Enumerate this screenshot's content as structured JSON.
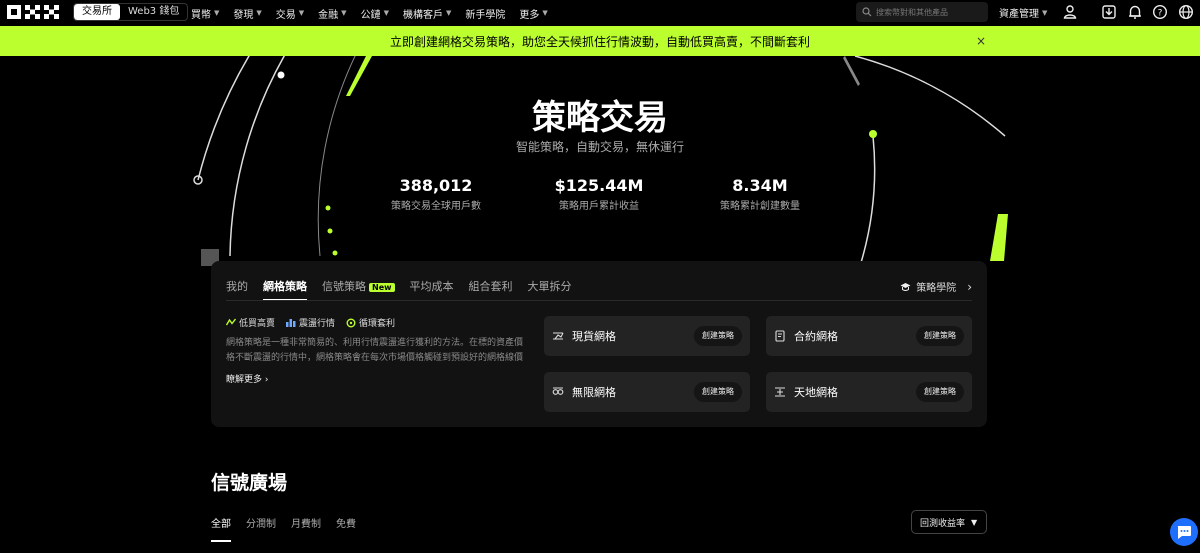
{
  "nav": {
    "segment": [
      "交易所",
      "Web3 錢包"
    ],
    "menu": [
      "買幣",
      "發現",
      "交易",
      "金融",
      "公鏈",
      "機構客戶",
      "新手學院",
      "更多"
    ],
    "search_placeholder": "搜索幣對和其他產品",
    "asset_label": "資產管理"
  },
  "banner": {
    "text": "立即創建網格交易策略，助您全天候抓住行情波動，自動低買高賣，不間斷套利",
    "close": "×"
  },
  "hero": {
    "title": "策略交易",
    "subtitle": "智能策略，自動交易，無休運行",
    "stats": [
      {
        "value": "388,012",
        "label": "策略交易全球用戶數"
      },
      {
        "value": "$125.44M",
        "label": "策略用戶累計收益"
      },
      {
        "value": "8.34M",
        "label": "策略累計創建數量"
      }
    ]
  },
  "panel": {
    "tabs": [
      "我的",
      "網格策略",
      "信號策略",
      "平均成本",
      "組合套利",
      "大單拆分"
    ],
    "new_badge": "New",
    "academy": "策略學院",
    "features": [
      "低買高賣",
      "震盪行情",
      "循環套利"
    ],
    "description": "網格策略是一種非常簡易的、利用行情震盪進行獲利的方法。在標的資產價格不斷震盪的行情中，網格策略會在每次市場價格觸碰到預設好的網格線價格...",
    "learn_more": "瞭解更多",
    "cards": [
      {
        "label": "現貨網格",
        "button": "創建策略",
        "icon": "spot-grid-icon"
      },
      {
        "label": "合約網格",
        "button": "創建策略",
        "icon": "contract-grid-icon"
      },
      {
        "label": "無限網格",
        "button": "創建策略",
        "icon": "infinity-grid-icon"
      },
      {
        "label": "天地網格",
        "button": "創建策略",
        "icon": "moon-grid-icon"
      }
    ]
  },
  "signals": {
    "title": "信號廣場",
    "tabs": [
      "全部",
      "分潤制",
      "月費制",
      "免費"
    ],
    "sort": "回測收益率"
  },
  "colors": {
    "accent": "#bcff2f",
    "chat": "#1f6fff"
  }
}
